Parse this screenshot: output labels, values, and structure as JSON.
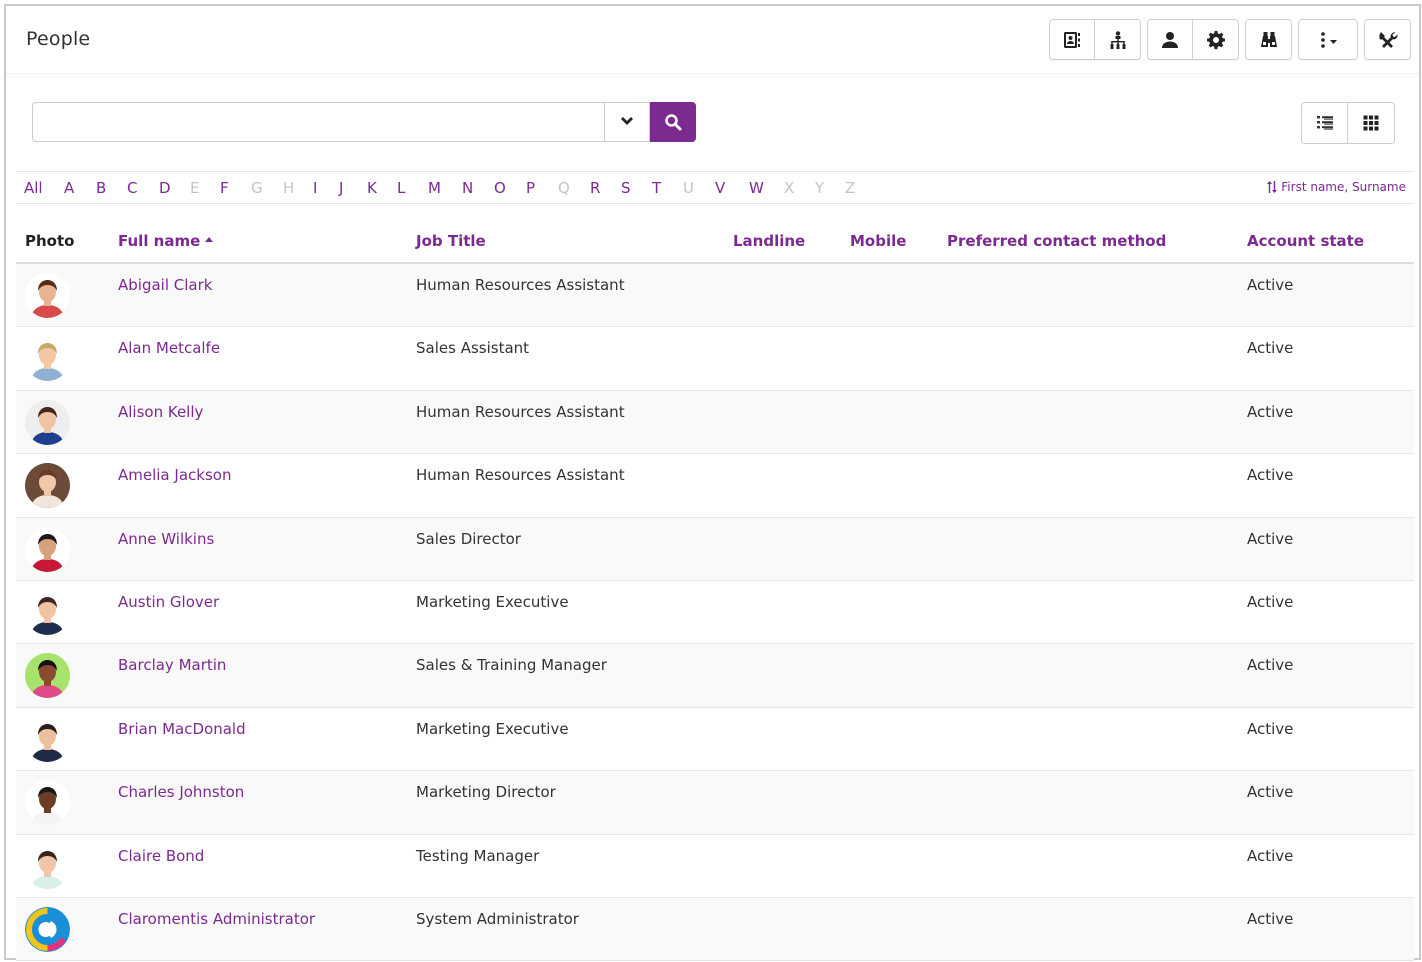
{
  "header": {
    "title": "People",
    "toolbar_icons": [
      "contact-card-icon",
      "org-chart-icon",
      "user-icon",
      "gear-icon",
      "binoculars-icon",
      "more-options-icon",
      "tools-icon"
    ]
  },
  "search": {
    "value": "",
    "placeholder": "",
    "accent_color": "#7b2a8f"
  },
  "view_toggle": [
    "list-view-icon",
    "grid-view-icon"
  ],
  "alphabet": {
    "all_label": "All",
    "letters": [
      {
        "l": "A",
        "enabled": true
      },
      {
        "l": "B",
        "enabled": true
      },
      {
        "l": "C",
        "enabled": true
      },
      {
        "l": "D",
        "enabled": true
      },
      {
        "l": "E",
        "enabled": false
      },
      {
        "l": "F",
        "enabled": true
      },
      {
        "l": "G",
        "enabled": false
      },
      {
        "l": "H",
        "enabled": false
      },
      {
        "l": "I",
        "enabled": true
      },
      {
        "l": "J",
        "enabled": true
      },
      {
        "l": "K",
        "enabled": true
      },
      {
        "l": "L",
        "enabled": true
      },
      {
        "l": "M",
        "enabled": true
      },
      {
        "l": "N",
        "enabled": true
      },
      {
        "l": "O",
        "enabled": true
      },
      {
        "l": "P",
        "enabled": true
      },
      {
        "l": "Q",
        "enabled": false
      },
      {
        "l": "R",
        "enabled": true
      },
      {
        "l": "S",
        "enabled": true
      },
      {
        "l": "T",
        "enabled": true
      },
      {
        "l": "U",
        "enabled": false
      },
      {
        "l": "V",
        "enabled": true
      },
      {
        "l": "W",
        "enabled": true
      },
      {
        "l": "X",
        "enabled": false
      },
      {
        "l": "Y",
        "enabled": false
      },
      {
        "l": "Z",
        "enabled": false
      }
    ],
    "sort_label": "First name, Surname"
  },
  "table": {
    "columns": {
      "photo": "Photo",
      "full_name": "Full name",
      "job_title": "Job Title",
      "landline": "Landline",
      "mobile": "Mobile",
      "preferred_contact": "Preferred contact method",
      "account_state": "Account state"
    },
    "rows": [
      {
        "name": "Abigail Clark",
        "job": "Human Resources Assistant",
        "state": "Active",
        "skin": "#e8b48f",
        "hair": "#5a2a14",
        "shirt": "#d94a4a",
        "bg": "#ffffff"
      },
      {
        "name": "Alan Metcalfe",
        "job": "Sales Assistant",
        "state": "Active",
        "skin": "#f1c8a3",
        "hair": "#c9a86a",
        "shirt": "#8fb0d0",
        "bg": "#ffffff"
      },
      {
        "name": "Alison Kelly",
        "job": "Human Resources Assistant",
        "state": "Active",
        "skin": "#efc4a4",
        "hair": "#4a2416",
        "shirt": "#1d3f8f",
        "bg": "#eeeeee"
      },
      {
        "name": "Amelia Jackson",
        "job": "Human Resources Assistant",
        "state": "Active",
        "skin": "#f0c7a8",
        "hair": "#6b3b22",
        "shirt": "#f2e6dc",
        "bg": "#6b4a3a"
      },
      {
        "name": "Anne Wilkins",
        "job": "Sales Director",
        "state": "Active",
        "skin": "#d9a07c",
        "hair": "#1a1a1a",
        "shirt": "#c8183a",
        "bg": "#ffffff"
      },
      {
        "name": "Austin Glover",
        "job": "Marketing Executive",
        "state": "Active",
        "skin": "#f0c4a2",
        "hair": "#3a2a22",
        "shirt": "#1f2d4f",
        "bg": "#ffffff"
      },
      {
        "name": "Barclay Martin",
        "job": "Sales & Training Manager",
        "state": "Active",
        "skin": "#8b4a2e",
        "hair": "#111111",
        "shirt": "#e04a8a",
        "bg": "#a7e36a"
      },
      {
        "name": "Brian MacDonald",
        "job": "Marketing Executive",
        "state": "Active",
        "skin": "#eebf9d",
        "hair": "#2a1f1a",
        "shirt": "#1f2a44",
        "bg": "#ffffff"
      },
      {
        "name": "Charles Johnston",
        "job": "Marketing Director",
        "state": "Active",
        "skin": "#6e3e24",
        "hair": "#1a1a1a",
        "shirt": "#f4f4f4",
        "bg": "#ffffff"
      },
      {
        "name": "Claire Bond",
        "job": "Testing Manager",
        "state": "Active",
        "skin": "#f0c6a6",
        "hair": "#3a2418",
        "shirt": "#d9efe9",
        "bg": "#ffffff"
      },
      {
        "name": "Claromentis Administrator",
        "job": "System Administrator",
        "state": "Active",
        "skin": "",
        "hair": "",
        "shirt": "",
        "bg": "logo"
      }
    ]
  }
}
